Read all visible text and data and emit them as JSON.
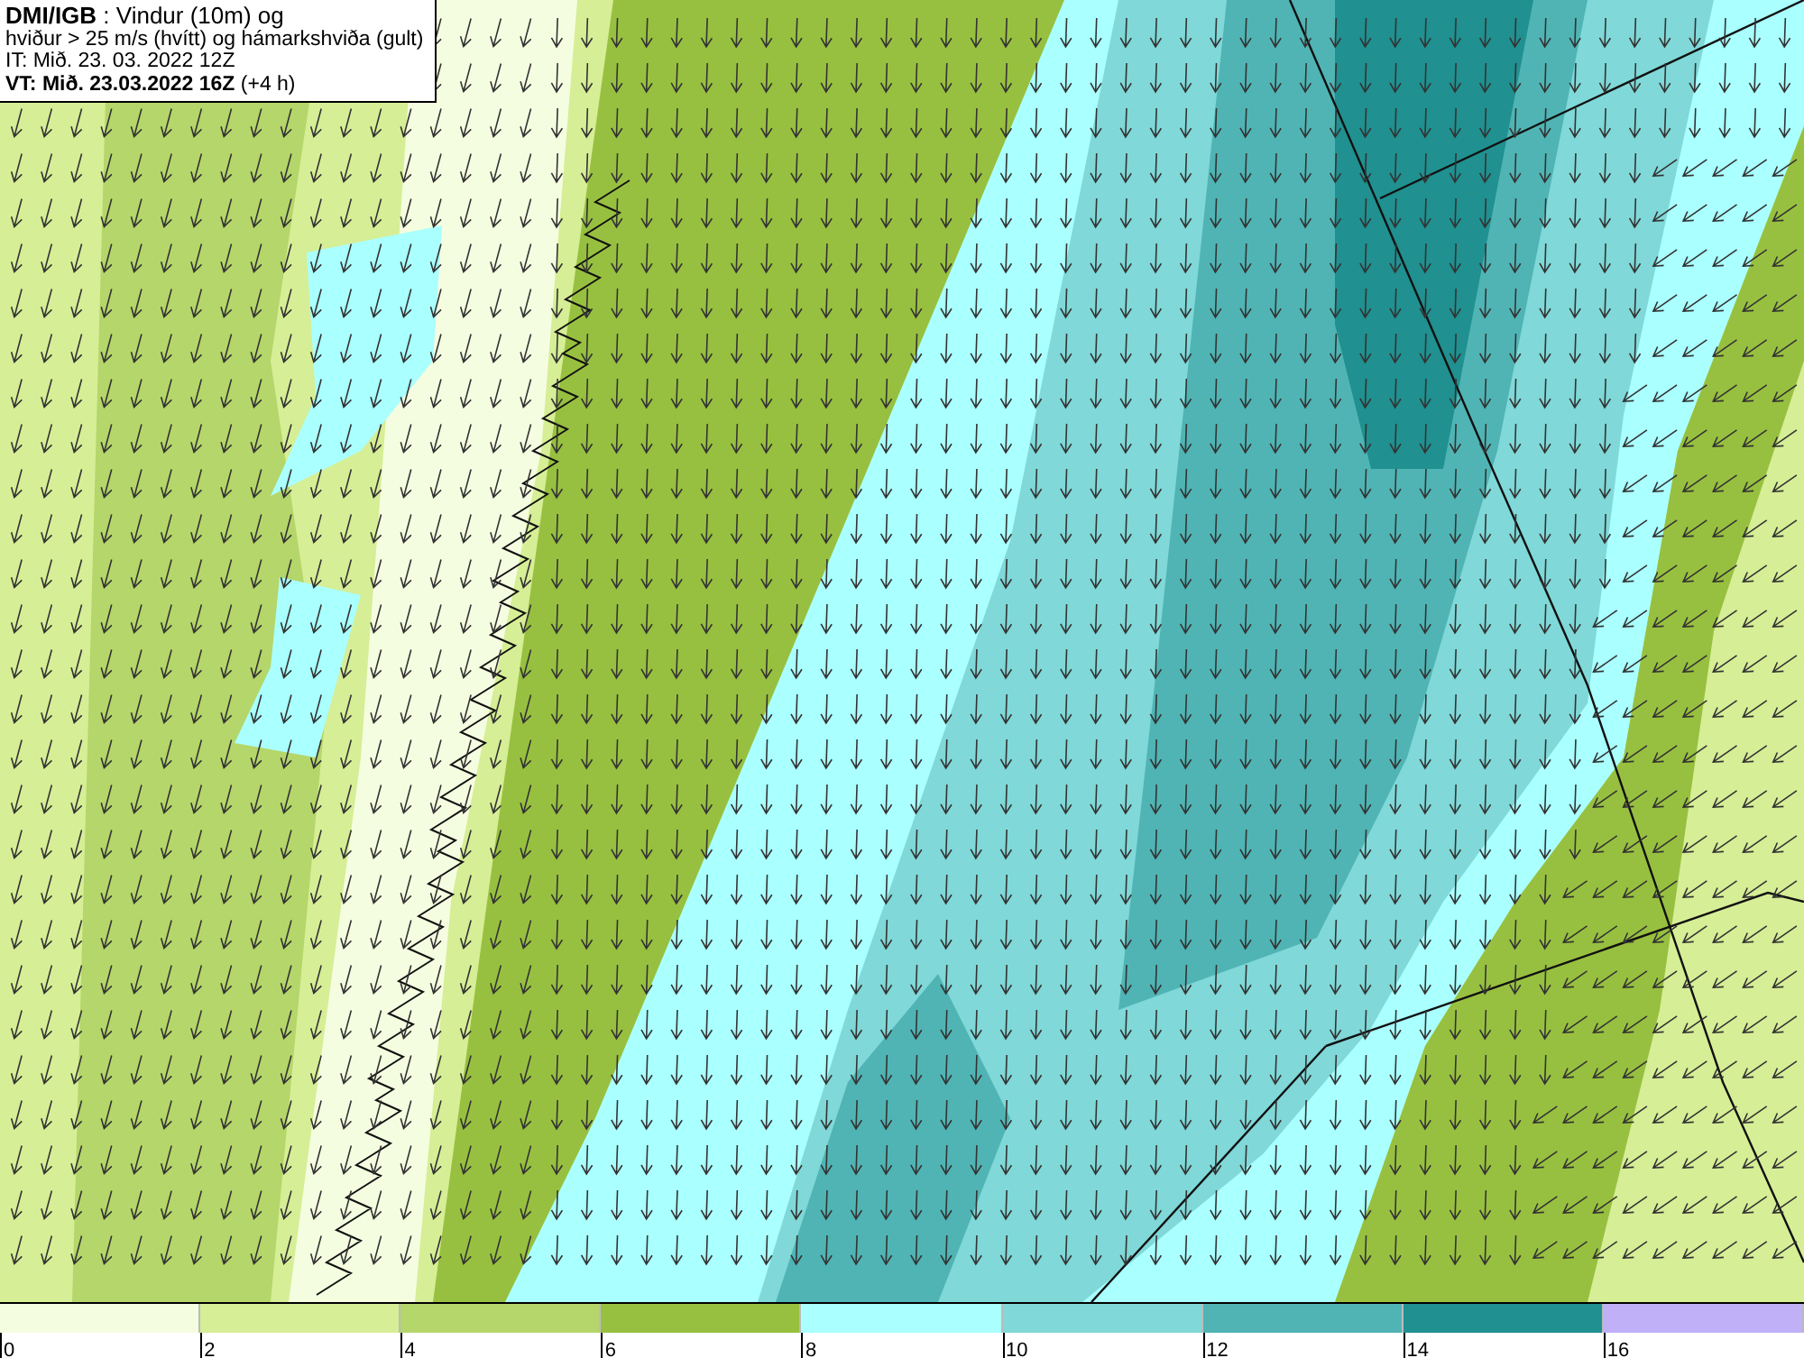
{
  "title_box": {
    "lines": [
      "**DMI/IGB** : Vindur (10m) og",
      "hviður > 25 m/s (hvítt) og hámarkshviða (gult)",
      "IT: Mið. 23. 03. 2022 12Z",
      "**VT: Mið. 23.03.2022 16Z** (+4 h)"
    ]
  },
  "legend": {
    "bins": [
      {
        "color": "#f5fde0"
      },
      {
        "color": "#d6ee96"
      },
      {
        "color": "#b5d66a"
      },
      {
        "color": "#98c040"
      },
      {
        "color": "#aaffff"
      },
      {
        "color": "#80d8d8"
      },
      {
        "color": "#50b4b4"
      },
      {
        "color": "#209090"
      },
      {
        "color": "#c0b0f8"
      }
    ],
    "ticks": [
      "0",
      "2",
      "4",
      "6",
      "8",
      "10",
      "12",
      "14",
      "16"
    ]
  }
}
